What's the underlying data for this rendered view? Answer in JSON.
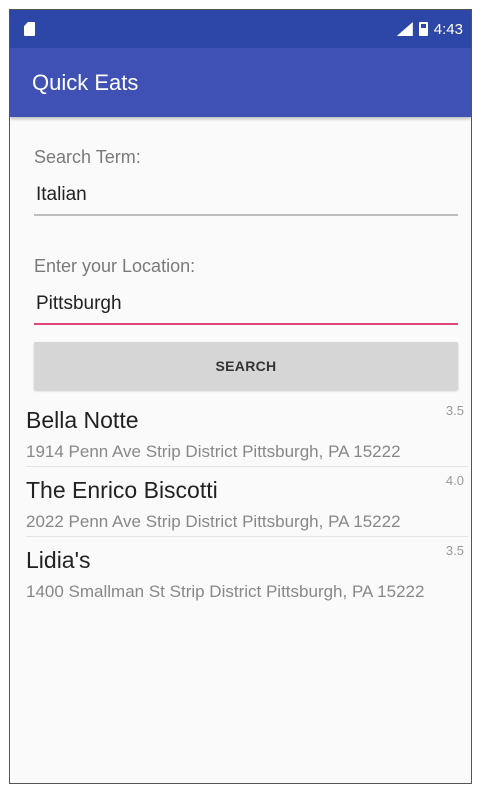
{
  "status_bar": {
    "time": "4:43"
  },
  "app_bar": {
    "title": "Quick Eats"
  },
  "search_term": {
    "label": "Search Term:",
    "value": "Italian"
  },
  "location": {
    "label": "Enter your Location:",
    "value": "Pittsburgh"
  },
  "search_button": {
    "label": "SEARCH"
  },
  "results": [
    {
      "name": "Bella Notte",
      "rating": "3.5",
      "address": "1914 Penn Ave Strip District Pittsburgh, PA 15222"
    },
    {
      "name": "The Enrico Biscotti",
      "rating": "4.0",
      "address": "2022 Penn Ave Strip District Pittsburgh, PA 15222"
    },
    {
      "name": "Lidia's",
      "rating": "3.5",
      "address": "1400 Smallman St Strip District Pittsburgh, PA 15222"
    }
  ],
  "colors": {
    "status_bar": "#2d47a8",
    "app_bar": "#3f51b5",
    "accent": "#e0457a"
  },
  "icons": [
    "sd-card-icon",
    "signal-icon",
    "battery-icon"
  ]
}
